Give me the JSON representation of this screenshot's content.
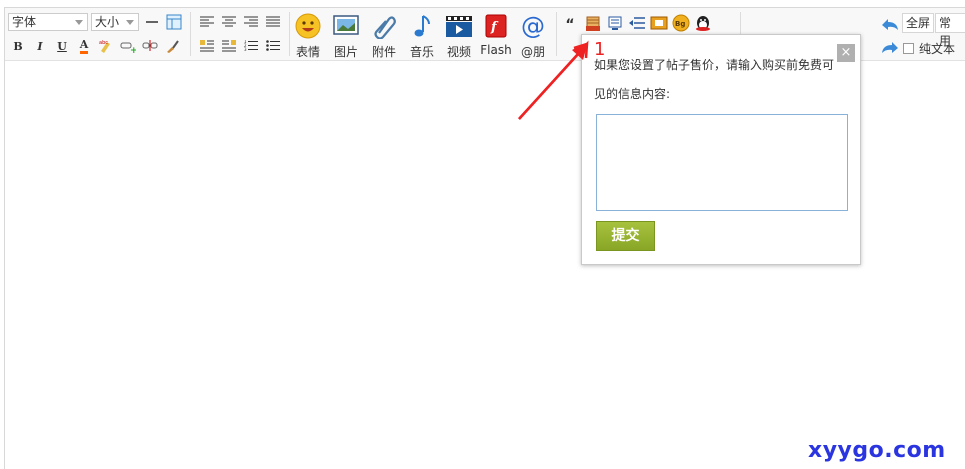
{
  "toolbar": {
    "font_select": "字体",
    "size_select": "大小",
    "rows_small_row1": [
      "hr",
      "table"
    ],
    "bold": "B",
    "italic": "I",
    "underline": "U",
    "forecolor": "A",
    "big_buttons": [
      {
        "label": "表情",
        "icon": "smiley-icon"
      },
      {
        "label": "图片",
        "icon": "image-icon"
      },
      {
        "label": "附件",
        "icon": "paperclip-icon"
      },
      {
        "label": "音乐",
        "icon": "music-note-icon"
      },
      {
        "label": "视频",
        "icon": "video-icon"
      },
      {
        "label": "Flash",
        "icon": "flash-icon"
      },
      {
        "label": "@朋",
        "icon": "at-icon"
      }
    ],
    "quote": "“",
    "fullscreen": "全屏",
    "common": "常用",
    "plain_text": "纯文本"
  },
  "popup": {
    "message": "如果您设置了帖子售价，请输入购买前免费可见的信息内容:",
    "submit": "提交",
    "close": "×",
    "textarea_value": ""
  },
  "annotation": {
    "number": "1"
  },
  "watermark": "xyygo.com",
  "colors": {
    "accent_green": "#8fac2b",
    "annotation_red": "#e22222",
    "watermark_blue": "#2a35e0"
  }
}
